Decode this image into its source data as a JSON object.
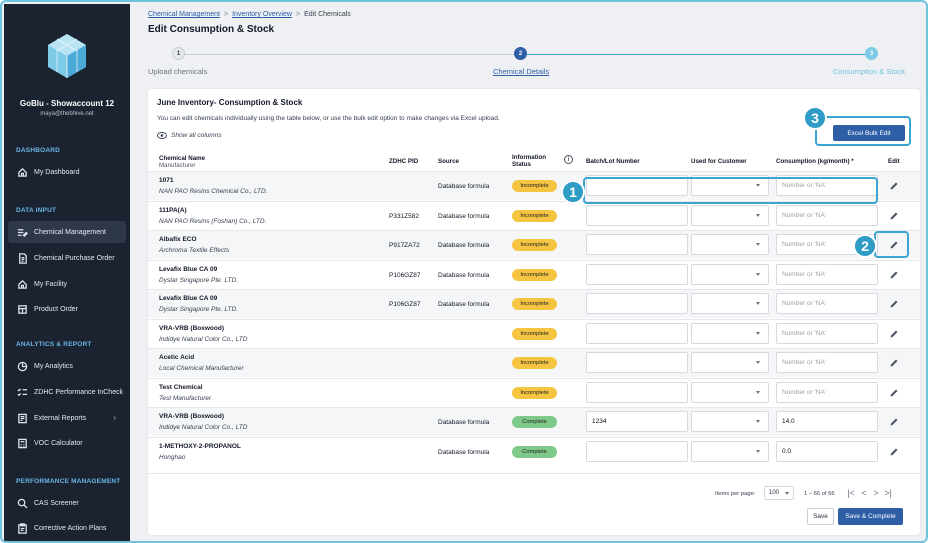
{
  "sidebar": {
    "account_name": "GoBlu - Showaccount 12",
    "account_email": "maya@thebhive.net",
    "sections": [
      {
        "title": "DASHBOARD",
        "items": [
          {
            "label": "My Dashboard",
            "icon": "home-icon"
          }
        ]
      },
      {
        "title": "DATA INPUT",
        "items": [
          {
            "label": "Chemical Management",
            "icon": "edit-list-icon",
            "active": true
          },
          {
            "label": "Chemical Purchase Order",
            "icon": "document-icon"
          },
          {
            "label": "My Facility",
            "icon": "home-icon"
          },
          {
            "label": "Product Order",
            "icon": "box-icon"
          }
        ]
      },
      {
        "title": "ANALYTICS & REPORT",
        "items": [
          {
            "label": "My Analytics",
            "icon": "analytics-icon"
          },
          {
            "label": "ZDHC Performance InCheck",
            "icon": "checklist-icon"
          },
          {
            "label": "External Reports",
            "icon": "report-icon"
          },
          {
            "label": "VOC Calculator",
            "icon": "calculator-icon"
          }
        ]
      },
      {
        "title": "PERFORMANCE MANAGEMENT",
        "items": [
          {
            "label": "CAS Screener",
            "icon": "search-icon"
          },
          {
            "label": "Corrective Action Plans",
            "icon": "clipboard-icon"
          }
        ]
      }
    ]
  },
  "breadcrumb": {
    "level1": "Chemical Management",
    "level2": "Inventory Overview",
    "current": "Edit Chemicals",
    "separator": ">"
  },
  "page_title": "Edit Consumption & Stock",
  "stepper": {
    "steps": [
      {
        "num": "1",
        "label": "Upload chemicals"
      },
      {
        "num": "2",
        "label": "Chemical Details"
      },
      {
        "num": "3",
        "label": "Consumption & Stock"
      }
    ]
  },
  "inventory": {
    "title": "June Inventory- Consumption & Stock",
    "description": "You can edit chemicals individually using the table below, or use the bulk edit option to make changes via Excel upload.",
    "show_all_columns": "Show all columns",
    "bulk_edit_label": "Excel Bulk Edit"
  },
  "callouts": {
    "one": "1",
    "two": "2",
    "three": "3"
  },
  "table": {
    "headers": {
      "name": "Chemical Name",
      "manufacturer": "Manufacturer",
      "pid": "ZDHC PID",
      "source": "Source",
      "status_line1": "Information",
      "status_line2": "Status",
      "status_info": "i",
      "batch": "Batch/Lot Number",
      "customer": "Used for Customer",
      "consumption": "Consumption (kg/month) *",
      "edit": "Edit"
    },
    "consumption_placeholder": "Number or 'NA'",
    "rows": [
      {
        "name": "1071",
        "manufacturer": "NAN PAO Resins Chemical Co., LTD.",
        "pid": "",
        "source": "Database formula",
        "status": "Incomplete",
        "batch": "",
        "consumption": ""
      },
      {
        "name": "111PA(A)",
        "manufacturer": "NAN PAO Resins (Foshan) Co., LTD.",
        "pid": "P331Z582",
        "source": "Database formula",
        "status": "Incomplete",
        "batch": "",
        "consumption": ""
      },
      {
        "name": "Albafix ECO",
        "manufacturer": "Archroma Textile Effects",
        "pid": "P917ZA72",
        "source": "Database formula",
        "status": "Incomplete",
        "batch": "",
        "consumption": ""
      },
      {
        "name": "Levafix Blue CA 09",
        "manufacturer": "Dystar Singapore Pte. LTD.",
        "pid": "P106GZ87",
        "source": "Database formula",
        "status": "Incomplete",
        "batch": "",
        "consumption": ""
      },
      {
        "name": "Levafix Blue CA 09",
        "manufacturer": "Dystar Singapore Pte. LTD.",
        "pid": "P106GZ87",
        "source": "Database formula",
        "status": "Incomplete",
        "batch": "",
        "consumption": ""
      },
      {
        "name": "VRA-VRB (Boxwood)",
        "manufacturer": "Indidye Natural Color Co., LTD",
        "pid": "",
        "source": "",
        "status": "Incomplete",
        "batch": "",
        "consumption": ""
      },
      {
        "name": "Acetic Acid",
        "manufacturer": "Local Chemical Manufacturer",
        "pid": "",
        "source": "",
        "status": "Incomplete",
        "batch": "",
        "consumption": ""
      },
      {
        "name": "Test Chemical",
        "manufacturer": "Test Manufacturer",
        "pid": "",
        "source": "",
        "status": "Incomplete",
        "batch": "",
        "consumption": ""
      },
      {
        "name": "VRA-VRB (Boxwood)",
        "manufacturer": "Indidye Natural Color Co., LTD",
        "pid": "",
        "source": "Database formula",
        "status": "Complete",
        "batch": "1234",
        "consumption": "14.0"
      },
      {
        "name": "1-METHOXY-2-PROPANOL",
        "manufacturer": "Honghao",
        "pid": "",
        "source": "Database formula",
        "status": "Complete",
        "batch": "",
        "consumption": "0.0"
      }
    ]
  },
  "footer": {
    "items_per_page_label": "Items per page:",
    "items_per_page": "100",
    "range": "1 – 66 of 66",
    "first": "|<",
    "prev": "<",
    "next": ">",
    "last": ">|",
    "save": "Save",
    "save_complete": "Save & Complete"
  },
  "colors": {
    "sidebar_bg": "#1b2230",
    "accent_blue": "#2e5ea6",
    "callout": "#2f9cc6",
    "incomplete": "#f5c542",
    "complete": "#7fc98b"
  }
}
